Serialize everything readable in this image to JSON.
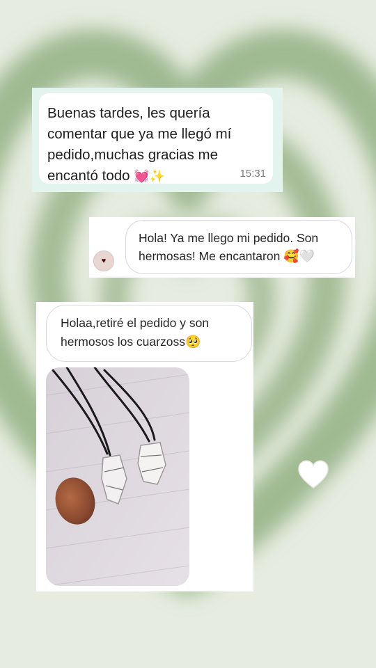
{
  "colors": {
    "background": "#e6ece0",
    "heart_ring_green": "#8fae7f",
    "whatsapp_bg": "#e3f3ee",
    "bubble_border": "#d9d9d9"
  },
  "whatsapp": {
    "message": "Buenas tardes, les quería comentar que ya me llegó mí pedido,muchas gracias me encantó todo",
    "emojis": "💓✨",
    "time": "15:31"
  },
  "instagram_dm": {
    "message": "Hola! Ya me llego mi pedido. Son hermosas! Me encantaron",
    "emojis": "🥰🤍",
    "avatar_icon": "dark-heart-icon"
  },
  "photo_message": {
    "message": "Holaa,retiré el pedido y son hermosos los cuarzoss",
    "emoji": "🥺",
    "photo_subject": "quartz-necklaces-photo"
  },
  "decoration": {
    "heart_icon": "white-heart-icon"
  }
}
